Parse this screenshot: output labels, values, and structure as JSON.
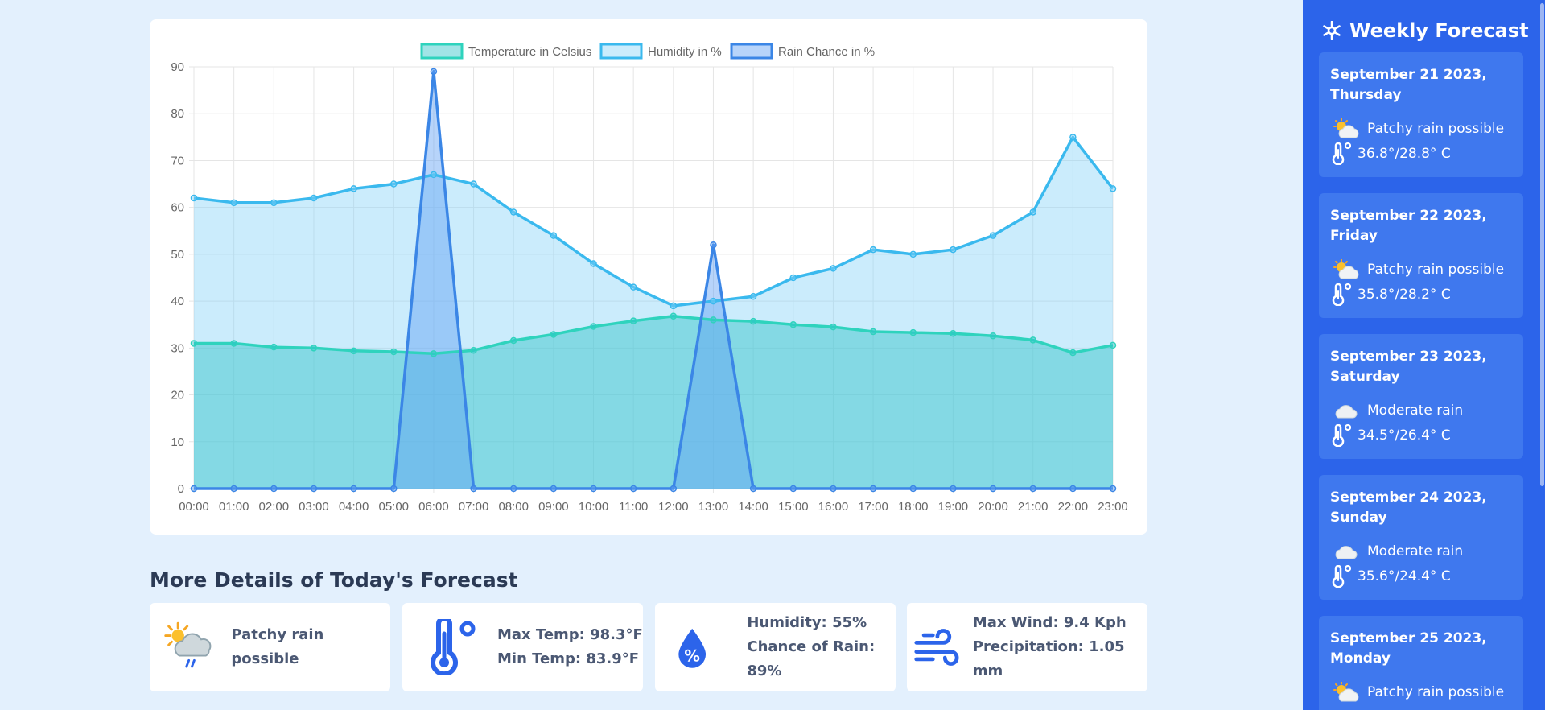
{
  "chart_data": {
    "type": "area",
    "legend_position": "top",
    "grid": true,
    "ylim": [
      0,
      90
    ],
    "y_ticks": [
      0,
      10,
      20,
      30,
      40,
      50,
      60,
      70,
      80,
      90
    ],
    "categories": [
      "00:00",
      "01:00",
      "02:00",
      "03:00",
      "04:00",
      "05:00",
      "06:00",
      "07:00",
      "08:00",
      "09:00",
      "10:00",
      "11:00",
      "12:00",
      "13:00",
      "14:00",
      "15:00",
      "16:00",
      "17:00",
      "18:00",
      "19:00",
      "20:00",
      "21:00",
      "22:00",
      "23:00"
    ],
    "series": [
      {
        "name": "Temperature in Celsius",
        "color": "#2fd3bd",
        "fill": "rgba(47, 196, 200, 0.45)",
        "values": [
          31,
          31,
          30.2,
          30,
          29.4,
          29.2,
          28.8,
          29.5,
          31.6,
          32.9,
          34.6,
          35.8,
          36.8,
          36,
          35.7,
          35,
          34.5,
          33.5,
          33.3,
          33.1,
          32.6,
          31.7,
          29,
          30.6
        ]
      },
      {
        "name": "Humidity in %",
        "color": "#3ab9ee",
        "fill": "rgba(132, 210, 248, 0.42)",
        "values": [
          62,
          61,
          61,
          62,
          64,
          65,
          67,
          65,
          59,
          54,
          48,
          43,
          39,
          40,
          41,
          45,
          47,
          51,
          50,
          51,
          54,
          59,
          75,
          64
        ]
      },
      {
        "name": "Rain Chance in %",
        "color": "#3b86e6",
        "fill": "rgba(95, 160, 245, 0.45)",
        "values": [
          0,
          0,
          0,
          0,
          0,
          0,
          89,
          0,
          0,
          0,
          0,
          0,
          0,
          52,
          0,
          0,
          0,
          0,
          0,
          0,
          0,
          0,
          0,
          0
        ]
      }
    ]
  },
  "details": {
    "title": "More Details of Today's Forecast",
    "condition": "Patchy rain possible",
    "max_temp": "Max Temp: 98.3°F",
    "min_temp": "Min Temp: 83.9°F",
    "humidity": "Humidity: 55%",
    "rain_chance": "Chance of Rain: 89%",
    "max_wind": "Max Wind: 9.4 Kph",
    "precipitation": "Precipitation: 1.05 mm"
  },
  "sidebar": {
    "title": "Weekly Forecast",
    "days": [
      {
        "date": "September 21 2023, Thursday",
        "condition": "Patchy rain possible",
        "icon": "sun-cloud-icon",
        "temps": "36.8°/28.8° C"
      },
      {
        "date": "September 22 2023, Friday",
        "condition": "Patchy rain possible",
        "icon": "sun-cloud-icon",
        "temps": "35.8°/28.2° C"
      },
      {
        "date": "September 23 2023, Saturday",
        "condition": "Moderate rain",
        "icon": "cloud-icon",
        "temps": "34.5°/26.4° C"
      },
      {
        "date": "September 24 2023, Sunday",
        "condition": "Moderate rain",
        "icon": "cloud-icon",
        "temps": "35.6°/24.4° C"
      },
      {
        "date": "September 25 2023, Monday",
        "condition": "Patchy rain possible",
        "icon": "sun-cloud-icon",
        "temps": ""
      }
    ]
  }
}
